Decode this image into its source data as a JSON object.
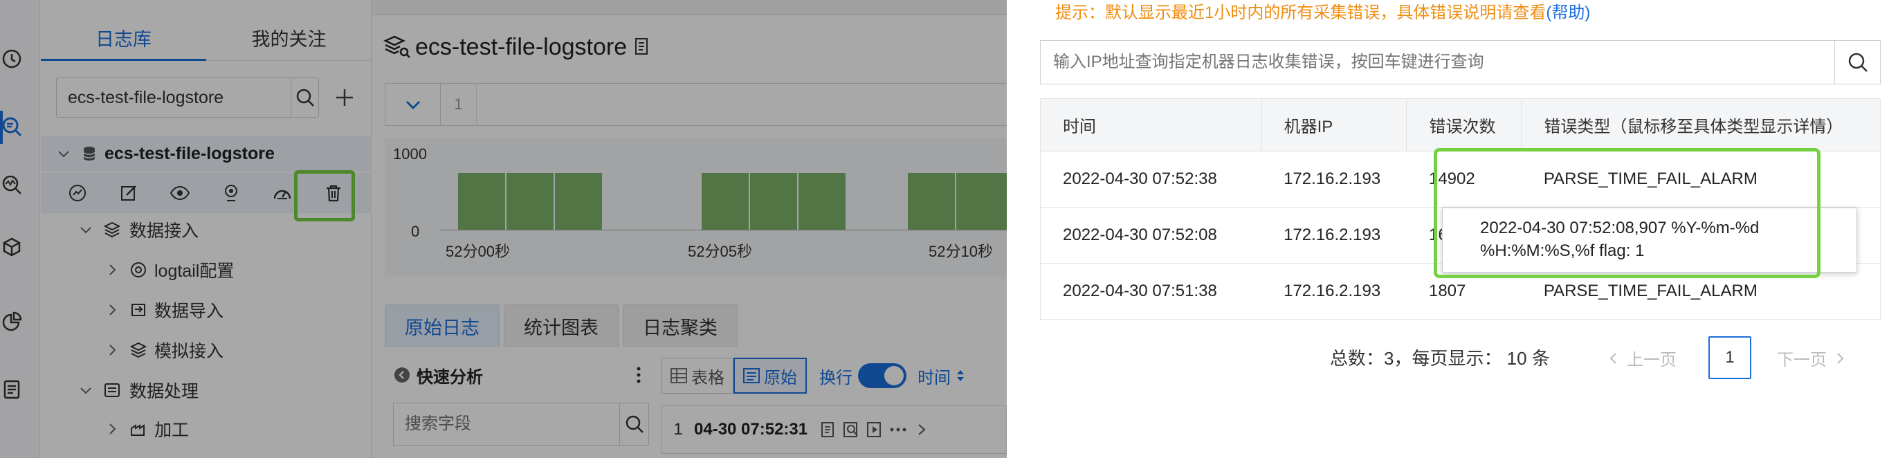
{
  "sidebar": {
    "tabs": [
      "日志库",
      "我的关注"
    ],
    "search_value": "ecs-test-file-logstore",
    "tree_root": "ecs-test-file-logstore",
    "nodes": {
      "data_ingest": "数据接入",
      "logtail_config": "logtail配置",
      "data_import": "数据导入",
      "simulated_ingest": "模拟接入",
      "data_processing": "数据处理",
      "processing": "加工"
    }
  },
  "main": {
    "title": "ecs-test-file-logstore",
    "query_line_number": "1",
    "histogram": {
      "yticks": [
        "1000",
        "0"
      ],
      "xticks": [
        "52分00秒",
        "52分05秒",
        "52分10秒"
      ]
    },
    "log_tabs": [
      "原始日志",
      "统计图表",
      "日志聚类"
    ],
    "quick_analysis": "快速分析",
    "field_search_placeholder": "搜索字段",
    "view": {
      "table": "表格",
      "raw": "原始",
      "wrap": "换行",
      "time": "时间"
    },
    "first_log": {
      "index": "1",
      "time": "04-30 07:52:31"
    }
  },
  "drawer": {
    "hint_text": "提示：默认显示最近1小时内的所有采集错误，具体错误说明请查看",
    "hint_link": "(帮助)",
    "ip_search_placeholder": "输入IP地址查询指定机器日志收集错误，按回车键进行查询",
    "table": {
      "headers": [
        "时间",
        "机器IP",
        "错误次数",
        "错误类型（鼠标移至具体类型显示详情）"
      ],
      "rows": [
        {
          "time": "2022-04-30 07:52:38",
          "ip": "172.16.2.193",
          "count": "14902",
          "type": "PARSE_TIME_FAIL_ALARM"
        },
        {
          "time": "2022-04-30 07:52:08",
          "ip": "172.16.2.193",
          "count": "16",
          "type": ""
        },
        {
          "time": "2022-04-30 07:51:38",
          "ip": "172.16.2.193",
          "count": "1807",
          "type": "PARSE_TIME_FAIL_ALARM"
        }
      ]
    },
    "tooltip": {
      "line1": "2022-04-30 07:52:08,907 %Y-%m-%d",
      "line2": "%H:%M:%S,%f flag: 1"
    },
    "pagination": {
      "summary": "总数：3，每页显示： 10 条",
      "prev": "上一页",
      "current": "1",
      "next": "下一页"
    }
  },
  "colors": {
    "accent": "#1a6fdd",
    "hint": "#f08c0f",
    "highlight": "#74d141",
    "bar": "#7db26a"
  }
}
